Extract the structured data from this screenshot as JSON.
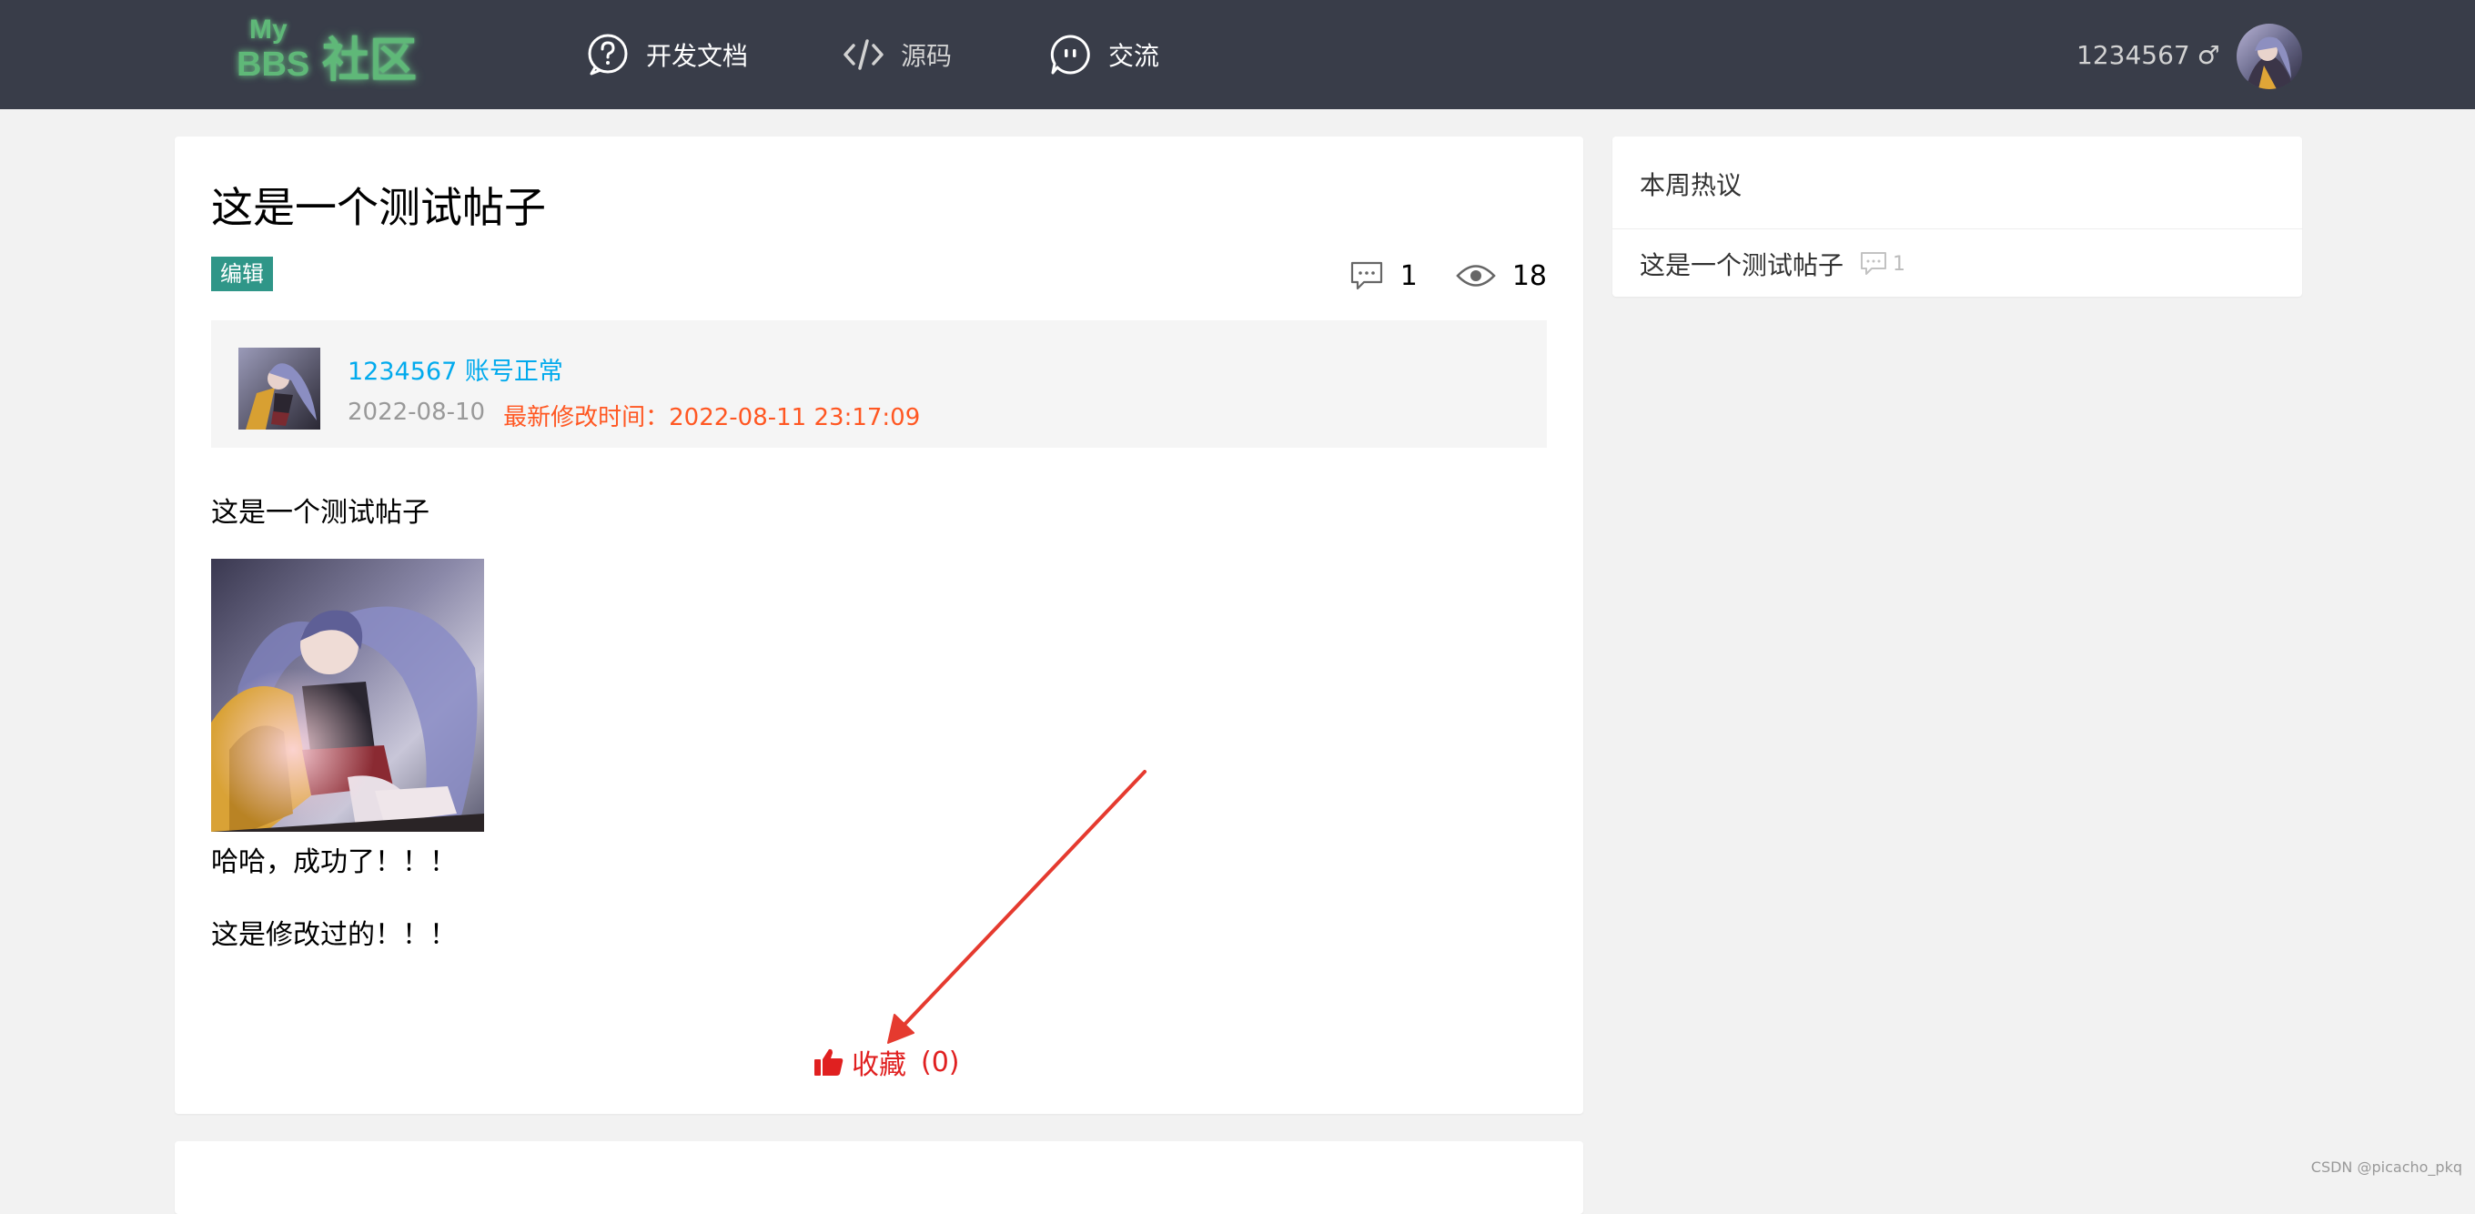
{
  "header": {
    "logo": {
      "my": "My",
      "bbs": "BBS",
      "cn": "社区"
    },
    "nav": [
      {
        "label": "开发文档",
        "icon": "help-circle-icon"
      },
      {
        "label": "源码",
        "icon": "code-icon"
      },
      {
        "label": "交流",
        "icon": "chat-icon"
      }
    ],
    "user": {
      "name": "1234567",
      "gender": "♂"
    },
    "colors": {
      "background": "#393d49",
      "logo": "#5fb878"
    }
  },
  "post": {
    "title": "这是一个测试帖子",
    "edit_label": "编辑",
    "comment_count": "1",
    "view_count": "18",
    "author": {
      "name": "1234567",
      "status": "账号正常",
      "created": "2022-08-10",
      "modified_label": "最新修改时间：",
      "modified": "2022-08-11 23:17:09"
    },
    "content": {
      "line1": "这是一个测试帖子",
      "line2": "哈哈，成功了！！！",
      "line3": "这是修改过的！！！"
    },
    "favorite": {
      "label": "收藏",
      "count": "(0)",
      "color": "#e02020"
    }
  },
  "sidebar": {
    "title": "本周热议",
    "items": [
      {
        "title": "这是一个测试帖子",
        "comments": "1"
      }
    ]
  },
  "annotation": {
    "arrow_color": "#e53a2f"
  },
  "watermark": "CSDN @picacho_pkq"
}
